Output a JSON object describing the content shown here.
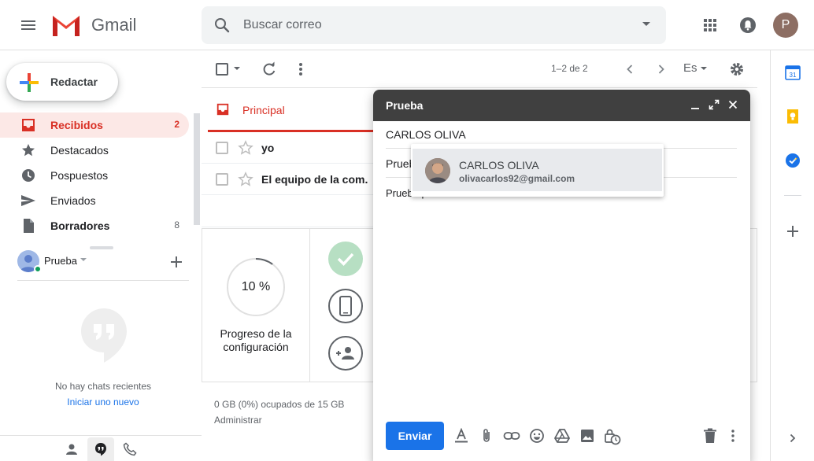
{
  "app": {
    "name": "Gmail"
  },
  "search": {
    "placeholder": "Buscar correo"
  },
  "header": {
    "avatar_letter": "P"
  },
  "compose_button": {
    "label": "Redactar"
  },
  "sidebar": {
    "items": [
      {
        "label": "Recibidos",
        "count": "2",
        "icon": "inbox-icon",
        "active": true
      },
      {
        "label": "Destacados",
        "count": "",
        "icon": "star-icon"
      },
      {
        "label": "Pospuestos",
        "count": "",
        "icon": "clock-icon"
      },
      {
        "label": "Enviados",
        "count": "",
        "icon": "send-icon"
      },
      {
        "label": "Borradores",
        "count": "8",
        "icon": "draft-icon"
      }
    ]
  },
  "hangouts": {
    "user": "Prueba",
    "empty_text": "No hay chats recientes",
    "start_link": "Iniciar uno nuevo"
  },
  "toolbar": {
    "pager": "1–2 de 2",
    "language": "Es"
  },
  "tabs": [
    {
      "label": "Principal",
      "icon": "inbox-icon"
    }
  ],
  "messages": [
    {
      "sender": "yo"
    },
    {
      "sender": "El equipo de la com."
    }
  ],
  "setup": {
    "progress_percent": 10,
    "progress_text": "10 %",
    "progress_label": "Progreso de la configuración"
  },
  "footer": {
    "storage": "0 GB (0%) ocupados de 15 GB",
    "manage": "Administrar"
  },
  "compose_window": {
    "title": "Prueba",
    "to": "CARLOS OLIVA",
    "subject_partial": "Prueb",
    "body_partial": "Prueba p",
    "send_label": "Enviar"
  },
  "suggestion": {
    "name": "CARLOS OLIVA",
    "email": "olivacarlos92@gmail.com"
  },
  "colors": {
    "accent_red": "#d93025",
    "send_blue": "#1a73e8",
    "compose_header": "#404040"
  }
}
